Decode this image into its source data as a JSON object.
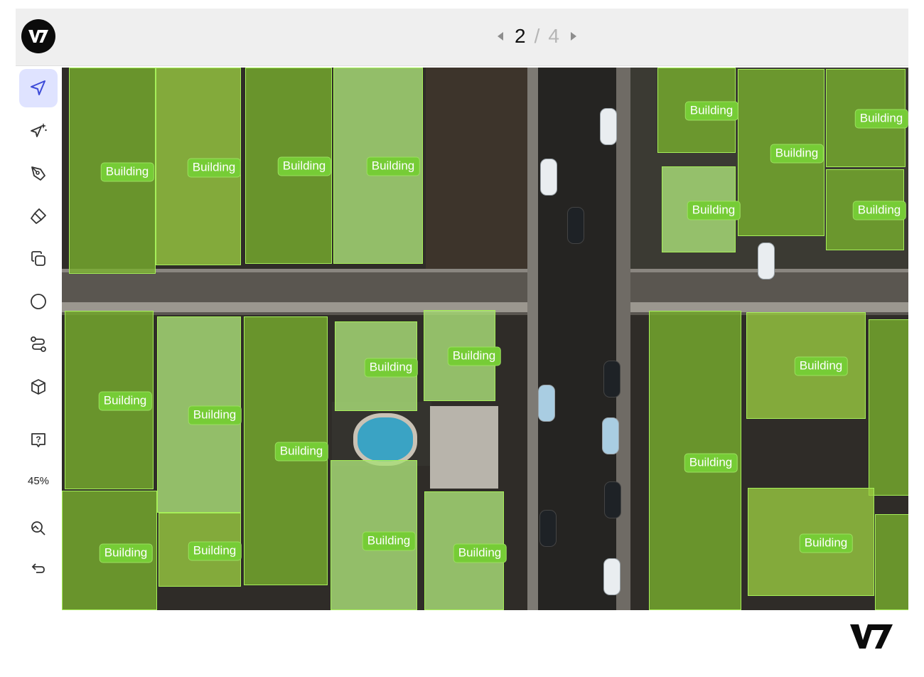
{
  "pager": {
    "current": "2",
    "separator": "/",
    "total": "4"
  },
  "toolbar": {
    "tools": [
      {
        "name": "select-tool",
        "icon": "pointer-icon",
        "active": true
      },
      {
        "name": "auto-annotate-tool",
        "icon": "sparkle-pointer-icon",
        "active": false
      },
      {
        "name": "pen-tool",
        "icon": "pen-nib-icon",
        "active": false
      },
      {
        "name": "brush-tool",
        "icon": "brush-icon",
        "active": false
      },
      {
        "name": "clone-tool",
        "icon": "copy-icon",
        "active": false
      },
      {
        "name": "ellipse-tool",
        "icon": "circle-icon",
        "active": false
      },
      {
        "name": "polyline-tool",
        "icon": "path-icon",
        "active": false
      },
      {
        "name": "cuboid-tool",
        "icon": "cube-icon",
        "active": false
      },
      {
        "name": "help-tool",
        "icon": "question-icon",
        "active": false
      }
    ],
    "zoom": "45%",
    "bottom_tools": [
      {
        "name": "zoom-reset-tool",
        "icon": "zoom-fit-icon"
      },
      {
        "name": "undo-tool",
        "icon": "undo-icon"
      }
    ]
  },
  "annotations": {
    "class_label": "Building",
    "accent_color": "#87d637"
  },
  "colors": {
    "topbar": "#efefef",
    "active_tool": "#dfe3ff",
    "logo_badge": "#0b0b0b"
  },
  "brand": {
    "logo": "V7"
  }
}
